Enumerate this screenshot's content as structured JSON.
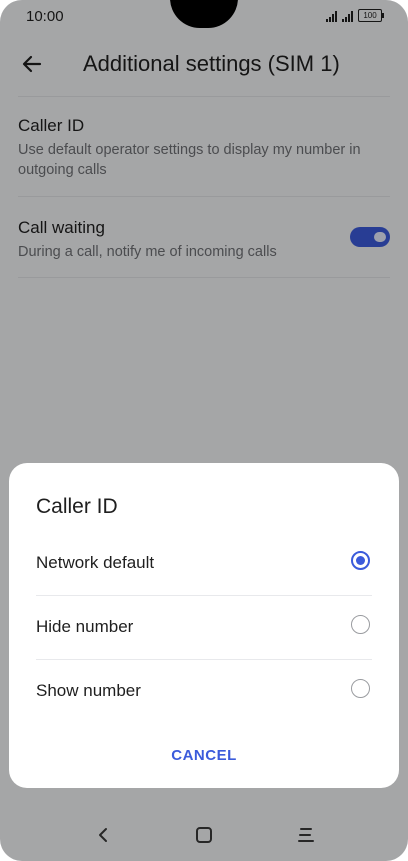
{
  "status_bar": {
    "time": "10:00",
    "battery": "100"
  },
  "header": {
    "title": "Additional settings (SIM 1)",
    "back_icon": "arrow-left-icon"
  },
  "settings": [
    {
      "title": "Caller ID",
      "subtitle": "Use default operator settings to display my number in outgoing calls"
    },
    {
      "title": "Call waiting",
      "subtitle": "During a call, notify me of incoming calls",
      "toggle_on": true
    }
  ],
  "dialog": {
    "title": "Caller ID",
    "options": [
      {
        "label": "Network default",
        "selected": true
      },
      {
        "label": "Hide number",
        "selected": false
      },
      {
        "label": "Show number",
        "selected": false
      }
    ],
    "cancel_label": "CANCEL"
  },
  "nav_bar": {
    "back": "chevron-left-icon",
    "home": "square-home-icon",
    "menu": "menu-icon"
  },
  "colors": {
    "accent": "#3b5bdb",
    "scrim": "rgba(0,0,0,0.32)"
  }
}
